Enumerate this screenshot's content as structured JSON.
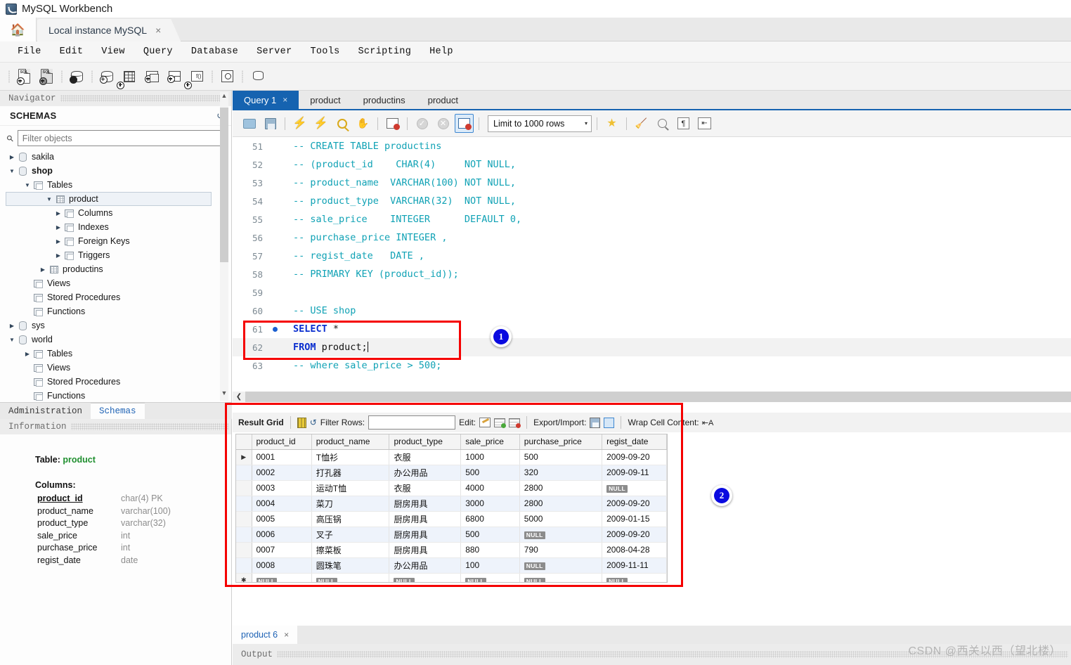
{
  "window": {
    "title": "MySQL Workbench",
    "app_icon": "dolphin-icon"
  },
  "instance_tab": {
    "label": "Local instance MySQL",
    "close": "×",
    "home_icon": "home-icon"
  },
  "menubar": {
    "items": [
      "File",
      "Edit",
      "View",
      "Query",
      "Database",
      "Server",
      "Tools",
      "Scripting",
      "Help"
    ]
  },
  "main_toolbar": {
    "icons": [
      "new-sql-tab-icon",
      "open-sql-script-icon",
      "server-status-icon",
      "new-schema-icon",
      "new-table-icon",
      "new-view-icon",
      "new-stored-procedure-icon",
      "new-function-icon",
      "inspect-object-icon",
      "reconnect-server-icon"
    ]
  },
  "navigator": {
    "header": "Navigator",
    "section_title": "SCHEMAS",
    "refresh_icon": "refresh-icon",
    "filter": {
      "placeholder": "Filter objects",
      "value": "",
      "icon": "search-icon"
    },
    "tree": [
      {
        "label": "sakila",
        "indent": 0,
        "arrow": "collapsed",
        "icon": "schema-icon",
        "bold": false,
        "selected": false
      },
      {
        "label": "shop",
        "indent": 0,
        "arrow": "expanded",
        "icon": "schema-icon",
        "bold": true,
        "selected": false
      },
      {
        "label": "Tables",
        "indent": 1,
        "arrow": "expanded",
        "icon": "folder-icon",
        "bold": false,
        "selected": false
      },
      {
        "label": "product",
        "indent": 2,
        "arrow": "expanded",
        "icon": "table-icon",
        "bold": false,
        "selected": true
      },
      {
        "label": "Columns",
        "indent": 3,
        "arrow": "collapsed",
        "icon": "columns-icon",
        "bold": false,
        "selected": false
      },
      {
        "label": "Indexes",
        "indent": 3,
        "arrow": "collapsed",
        "icon": "folder-icon",
        "bold": false,
        "selected": false
      },
      {
        "label": "Foreign Keys",
        "indent": 3,
        "arrow": "collapsed",
        "icon": "folder-icon",
        "bold": false,
        "selected": false
      },
      {
        "label": "Triggers",
        "indent": 3,
        "arrow": "collapsed",
        "icon": "folder-icon",
        "bold": false,
        "selected": false
      },
      {
        "label": "productins",
        "indent": 2,
        "arrow": "collapsed",
        "icon": "table-icon",
        "bold": false,
        "selected": false
      },
      {
        "label": "Views",
        "indent": 1,
        "arrow": "none",
        "icon": "folder-icon",
        "bold": false,
        "selected": false
      },
      {
        "label": "Stored Procedures",
        "indent": 1,
        "arrow": "none",
        "icon": "folder-icon",
        "bold": false,
        "selected": false
      },
      {
        "label": "Functions",
        "indent": 1,
        "arrow": "none",
        "icon": "folder-icon",
        "bold": false,
        "selected": false
      },
      {
        "label": "sys",
        "indent": 0,
        "arrow": "collapsed",
        "icon": "schema-icon",
        "bold": false,
        "selected": false
      },
      {
        "label": "world",
        "indent": 0,
        "arrow": "expanded",
        "icon": "schema-icon",
        "bold": false,
        "selected": false
      },
      {
        "label": "Tables",
        "indent": 1,
        "arrow": "collapsed",
        "icon": "folder-icon",
        "bold": false,
        "selected": false
      },
      {
        "label": "Views",
        "indent": 1,
        "arrow": "none",
        "icon": "folder-icon",
        "bold": false,
        "selected": false
      },
      {
        "label": "Stored Procedures",
        "indent": 1,
        "arrow": "none",
        "icon": "folder-icon",
        "bold": false,
        "selected": false
      },
      {
        "label": "Functions",
        "indent": 1,
        "arrow": "none",
        "icon": "folder-icon",
        "bold": false,
        "selected": false
      }
    ]
  },
  "nav_tabs": {
    "administration": "Administration",
    "schemas": "Schemas",
    "active": "Schemas"
  },
  "information": {
    "header": "Information",
    "table_label": "Table:",
    "table_name": "product",
    "columns_label": "Columns:",
    "columns": [
      {
        "name": "product_id",
        "type": "char(4) PK",
        "pk": true
      },
      {
        "name": "product_name",
        "type": "varchar(100)",
        "pk": false
      },
      {
        "name": "product_type",
        "type": "varchar(32)",
        "pk": false
      },
      {
        "name": "sale_price",
        "type": "int",
        "pk": false
      },
      {
        "name": "purchase_price",
        "type": "int",
        "pk": false
      },
      {
        "name": "regist_date",
        "type": "date",
        "pk": false
      }
    ]
  },
  "editor_tabs": [
    {
      "label": "Query 1",
      "active": true,
      "close": "×"
    },
    {
      "label": "product",
      "active": false,
      "close": ""
    },
    {
      "label": "productins",
      "active": false,
      "close": ""
    },
    {
      "label": "product",
      "active": false,
      "close": ""
    }
  ],
  "sql_toolbar": {
    "icons": [
      "open-script-icon",
      "save-script-icon",
      "execute-icon",
      "execute-current-icon",
      "explain-icon",
      "stop-icon",
      "toggle-breakpoint-icon",
      "commit-icon",
      "rollback-icon",
      "auto-commit-icon",
      "beautify-icon",
      "find-icon",
      "toggle-invisible-chars-icon",
      "toggle-wrap-icon"
    ],
    "limit_label": "Limit to 1000 rows",
    "limit_caret": "▾"
  },
  "code": {
    "lines": [
      {
        "num": "51",
        "text": "-- CREATE TABLE productins",
        "kind": "comment",
        "bp": false,
        "hl": false
      },
      {
        "num": "52",
        "text": "-- (product_id    CHAR(4)     NOT NULL,",
        "kind": "comment",
        "bp": false,
        "hl": false
      },
      {
        "num": "53",
        "text": "-- product_name  VARCHAR(100) NOT NULL,",
        "kind": "comment",
        "bp": false,
        "hl": false
      },
      {
        "num": "54",
        "text": "-- product_type  VARCHAR(32)  NOT NULL,",
        "kind": "comment",
        "bp": false,
        "hl": false
      },
      {
        "num": "55",
        "text": "-- sale_price    INTEGER      DEFAULT 0,",
        "kind": "comment",
        "bp": false,
        "hl": false
      },
      {
        "num": "56",
        "text": "-- purchase_price INTEGER ,",
        "kind": "comment",
        "bp": false,
        "hl": false
      },
      {
        "num": "57",
        "text": "-- regist_date   DATE ,",
        "kind": "comment",
        "bp": false,
        "hl": false
      },
      {
        "num": "58",
        "text": "-- PRIMARY KEY (product_id));",
        "kind": "comment",
        "bp": false,
        "hl": false
      },
      {
        "num": "59",
        "text": "",
        "kind": "blank",
        "bp": false,
        "hl": false
      },
      {
        "num": "60",
        "text": "-- USE shop",
        "kind": "comment",
        "bp": false,
        "hl": false
      },
      {
        "num": "61",
        "keyword": "SELECT",
        "rest": " *",
        "kind": "sql",
        "bp": true,
        "hl": false
      },
      {
        "num": "62",
        "keyword": "FROM",
        "rest": " product;",
        "kind": "sql-caret",
        "bp": false,
        "hl": true
      },
      {
        "num": "63",
        "text": "-- where sale_price > 500;",
        "kind": "comment",
        "bp": false,
        "hl": false
      }
    ]
  },
  "result_toolbar": {
    "result_grid_label": "Result Grid",
    "grid_icon": "grid-view-icon",
    "refresh_icon": "refresh-icon",
    "filter_label": "Filter Rows:",
    "filter_value": "",
    "edit_label": "Edit:",
    "edit_icons": [
      "edit-cell-icon",
      "insert-row-icon",
      "delete-row-icon"
    ],
    "export_label": "Export/Import:",
    "export_icons": [
      "export-recordset-icon",
      "import-recordset-icon"
    ],
    "wrap_label": "Wrap Cell Content:",
    "wrap_icon": "wrap-cell-icon"
  },
  "result_grid": {
    "columns": [
      "product_id",
      "product_name",
      "product_type",
      "sale_price",
      "purchase_price",
      "regist_date"
    ],
    "rows": [
      {
        "marker": "▶",
        "cells": [
          "0001",
          "T恤衫",
          "衣服",
          "1000",
          "500",
          "2009-09-20"
        ]
      },
      {
        "marker": "",
        "cells": [
          "0002",
          "打孔器",
          "办公用品",
          "500",
          "320",
          "2009-09-11"
        ]
      },
      {
        "marker": "",
        "cells": [
          "0003",
          "运动T恤",
          "衣服",
          "4000",
          "2800",
          "NULL"
        ]
      },
      {
        "marker": "",
        "cells": [
          "0004",
          "菜刀",
          "厨房用具",
          "3000",
          "2800",
          "2009-09-20"
        ]
      },
      {
        "marker": "",
        "cells": [
          "0005",
          "高压锅",
          "厨房用具",
          "6800",
          "5000",
          "2009-01-15"
        ]
      },
      {
        "marker": "",
        "cells": [
          "0006",
          "叉子",
          "厨房用具",
          "500",
          "NULL",
          "2009-09-20"
        ]
      },
      {
        "marker": "",
        "cells": [
          "0007",
          "擦菜板",
          "厨房用具",
          "880",
          "790",
          "2008-04-28"
        ]
      },
      {
        "marker": "",
        "cells": [
          "0008",
          "圆珠笔",
          "办公用品",
          "100",
          "NULL",
          "2009-11-11"
        ]
      },
      {
        "marker": "✱",
        "cells": [
          "NULL",
          "NULL",
          "NULL",
          "NULL",
          "NULL",
          "NULL"
        ]
      }
    ],
    "null_text": "NULL"
  },
  "annotations": [
    {
      "number": "1",
      "target": "sql-select-statement"
    },
    {
      "number": "2",
      "target": "result-grid"
    }
  ],
  "result_tab": {
    "label": "product 6",
    "close": "×"
  },
  "output": {
    "header": "Output"
  },
  "watermark": {
    "text": "CSDN @西关以西（望北楼）"
  }
}
